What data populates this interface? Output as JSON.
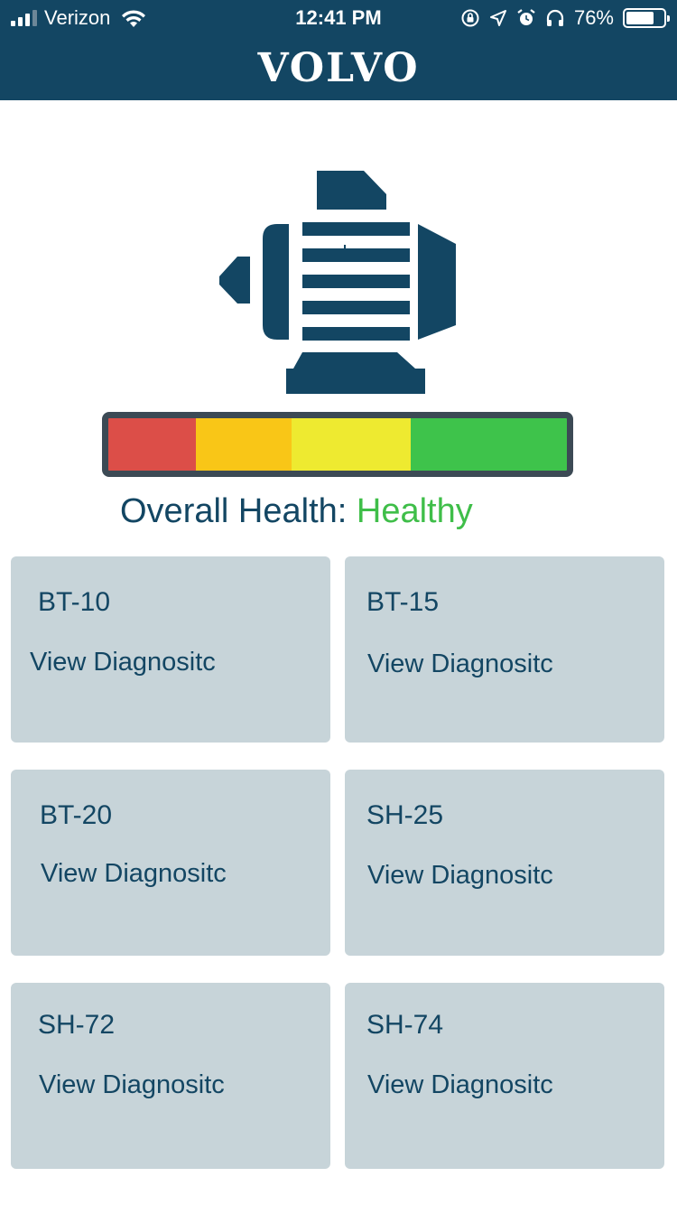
{
  "status_bar": {
    "carrier": "Verizon",
    "time": "12:41 PM",
    "battery_percent": "76%",
    "battery_level": 0.76,
    "icons": [
      "signal-icon",
      "wifi-icon",
      "orientation-lock-icon",
      "location-icon",
      "alarm-icon",
      "headphones-icon",
      "battery-icon"
    ]
  },
  "header": {
    "brand": "VOLVO"
  },
  "colors": {
    "header_bg": "#134663",
    "primary": "#134663",
    "card_bg": "#c7d4d9",
    "healthy": "#3fbe49"
  },
  "health": {
    "label": "Overall Health: ",
    "status": "Healthy",
    "bar_segments": [
      {
        "name": "critical",
        "color": "#dc4e48",
        "share": 0.19
      },
      {
        "name": "poor",
        "color": "#f9c617",
        "share": 0.21
      },
      {
        "name": "fair",
        "color": "#eeea30",
        "share": 0.26
      },
      {
        "name": "good",
        "color": "#3ec34b",
        "share": 0.34
      }
    ]
  },
  "sensors": [
    {
      "id": "BT-10",
      "action": "View Diagnositc"
    },
    {
      "id": "BT-15",
      "action": "View Diagnositc"
    },
    {
      "id": "BT-20",
      "action": "View Diagnositc"
    },
    {
      "id": "SH-25",
      "action": "View Diagnositc"
    },
    {
      "id": "SH-72",
      "action": "View Diagnositc"
    },
    {
      "id": "SH-74",
      "action": "View Diagnositc"
    }
  ]
}
